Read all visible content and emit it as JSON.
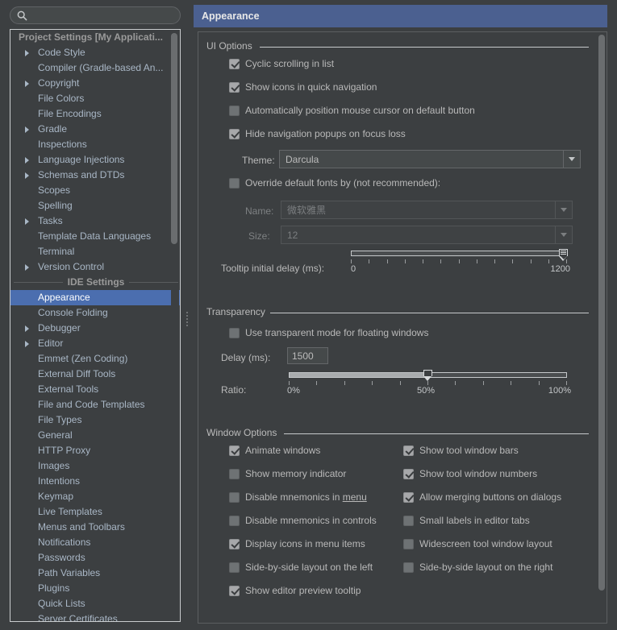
{
  "search": {
    "placeholder": "",
    "value": "",
    "icon": "search-icon"
  },
  "sidebar": {
    "project_settings_header": "Project Settings [My Applicati...",
    "ide_settings_header": "IDE Settings",
    "project_items": [
      {
        "label": "Code Style",
        "expandable": true
      },
      {
        "label": "Compiler (Gradle-based An...",
        "expandable": false
      },
      {
        "label": "Copyright",
        "expandable": true
      },
      {
        "label": "File Colors",
        "expandable": false
      },
      {
        "label": "File Encodings",
        "expandable": false
      },
      {
        "label": "Gradle",
        "expandable": true
      },
      {
        "label": "Inspections",
        "expandable": false
      },
      {
        "label": "Language Injections",
        "expandable": true
      },
      {
        "label": "Schemas and DTDs",
        "expandable": true
      },
      {
        "label": "Scopes",
        "expandable": false
      },
      {
        "label": "Spelling",
        "expandable": false
      },
      {
        "label": "Tasks",
        "expandable": true
      },
      {
        "label": "Template Data Languages",
        "expandable": false
      },
      {
        "label": "Terminal",
        "expandable": false
      },
      {
        "label": "Version Control",
        "expandable": true
      }
    ],
    "ide_items": [
      {
        "label": "Appearance",
        "expandable": false,
        "selected": true
      },
      {
        "label": "Console Folding",
        "expandable": false
      },
      {
        "label": "Debugger",
        "expandable": true
      },
      {
        "label": "Editor",
        "expandable": true
      },
      {
        "label": "Emmet (Zen Coding)",
        "expandable": false
      },
      {
        "label": "External Diff Tools",
        "expandable": false
      },
      {
        "label": "External Tools",
        "expandable": false
      },
      {
        "label": "File and Code Templates",
        "expandable": false
      },
      {
        "label": "File Types",
        "expandable": false
      },
      {
        "label": "General",
        "expandable": false
      },
      {
        "label": "HTTP Proxy",
        "expandable": false
      },
      {
        "label": "Images",
        "expandable": false
      },
      {
        "label": "Intentions",
        "expandable": false
      },
      {
        "label": "Keymap",
        "expandable": false
      },
      {
        "label": "Live Templates",
        "expandable": false
      },
      {
        "label": "Menus and Toolbars",
        "expandable": false
      },
      {
        "label": "Notifications",
        "expandable": false
      },
      {
        "label": "Passwords",
        "expandable": false
      },
      {
        "label": "Path Variables",
        "expandable": false
      },
      {
        "label": "Plugins",
        "expandable": false
      },
      {
        "label": "Quick Lists",
        "expandable": false
      },
      {
        "label": "Server Certificates",
        "expandable": false
      }
    ]
  },
  "page": {
    "title": "Appearance",
    "title_bar_color": "#4b6090",
    "selection_color": "#4b6eaf"
  },
  "ui_options": {
    "group_label": "UI Options",
    "checkboxes": [
      {
        "label": "Cyclic scrolling in list",
        "checked": true
      },
      {
        "label": "Show icons in quick navigation",
        "checked": true
      },
      {
        "label": "Automatically position mouse cursor on default button",
        "checked": false
      },
      {
        "label": "Hide navigation popups on focus loss",
        "checked": true
      }
    ],
    "theme_label": "Theme:",
    "theme_value": "Darcula",
    "override_fonts": {
      "label": "Override default fonts by (not recommended):",
      "checked": false
    },
    "name_label": "Name:",
    "name_value": "微软雅黑",
    "size_label": "Size:",
    "size_value": "12",
    "tooltip_delay": {
      "label": "Tooltip initial delay (ms):",
      "min_label": "0",
      "max_label": "1200",
      "min": 0,
      "max": 1200,
      "value": 1200,
      "ticks": 13
    }
  },
  "transparency": {
    "group_label": "Transparency",
    "use_transparent": {
      "label": "Use transparent mode for floating windows",
      "checked": false
    },
    "delay_label": "Delay (ms):",
    "delay_value": "1500",
    "ratio": {
      "label": "Ratio:",
      "min_label": "0%",
      "mid_label": "50%",
      "max_label": "100%",
      "min": 0,
      "max": 100,
      "value": 50,
      "ticks": 11
    }
  },
  "window_options": {
    "group_label": "Window Options",
    "left_column": [
      {
        "label": "Animate windows",
        "checked": true
      },
      {
        "label": "Show memory indicator",
        "checked": false
      },
      {
        "label": "Disable mnemonics in menu",
        "checked": false,
        "mnemonic": "menu"
      },
      {
        "label": "Disable mnemonics in controls",
        "checked": false
      },
      {
        "label": "Display icons in menu items",
        "checked": true
      },
      {
        "label": "Side-by-side layout on the left",
        "checked": false
      },
      {
        "label": "Show editor preview tooltip",
        "checked": true
      }
    ],
    "right_column": [
      {
        "label": "Show tool window bars",
        "checked": true
      },
      {
        "label": "Show tool window numbers",
        "checked": true
      },
      {
        "label": "Allow merging buttons on dialogs",
        "checked": true
      },
      {
        "label": "Small labels in editor tabs",
        "checked": false
      },
      {
        "label": "Widescreen tool window layout",
        "checked": false
      },
      {
        "label": "Side-by-side layout on the right",
        "checked": false
      }
    ]
  }
}
